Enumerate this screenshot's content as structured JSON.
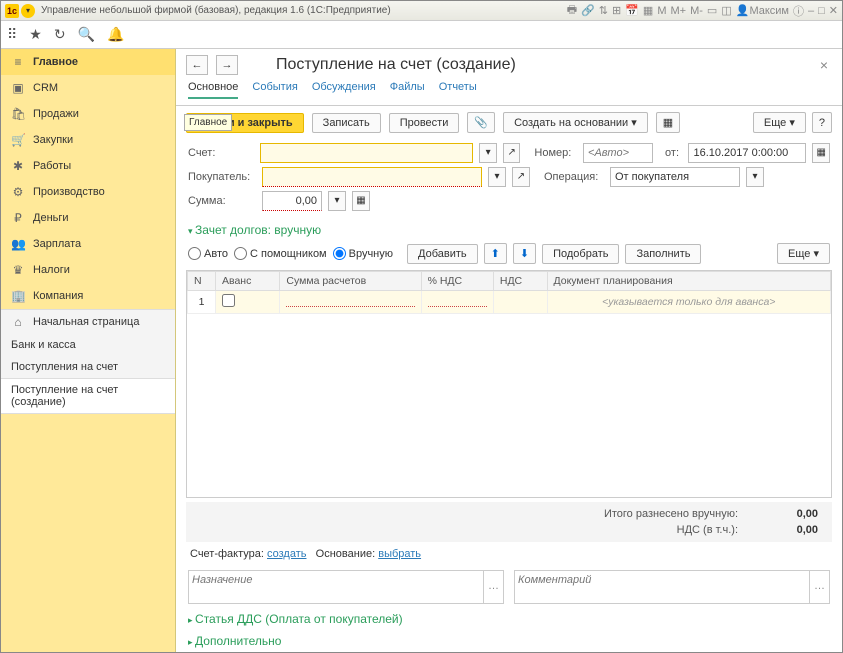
{
  "title": "Управление небольшой фирмой (базовая), редакция 1.6 (1С:Предприятие)",
  "user": "Максим",
  "sidebar": {
    "items": [
      {
        "icon": "≡",
        "label": "Главное"
      },
      {
        "icon": "▣",
        "label": "CRM"
      },
      {
        "icon": "🛍",
        "label": "Продажи"
      },
      {
        "icon": "🛒",
        "label": "Закупки"
      },
      {
        "icon": "✱",
        "label": "Работы"
      },
      {
        "icon": "⚙",
        "label": "Производство"
      },
      {
        "icon": "₽",
        "label": "Деньги"
      },
      {
        "icon": "👥",
        "label": "Зарплата"
      },
      {
        "icon": "♛",
        "label": "Налоги"
      },
      {
        "icon": "🏢",
        "label": "Компания"
      }
    ],
    "sub": [
      {
        "icon": "⌂",
        "label": "Начальная страница"
      },
      {
        "label": "Банк и касса"
      },
      {
        "label": "Поступления на счет"
      },
      {
        "label": "Поступление на счет (создание)"
      }
    ]
  },
  "doc": {
    "title": "Поступление на счет (создание)",
    "tabs": [
      "Основное",
      "События",
      "Обсуждения",
      "Файлы",
      "Отчеты"
    ],
    "tooltip": "Главное",
    "cmd": {
      "post_close": "овести и закрыть",
      "save": "Записать",
      "post": "Провести",
      "create_based": "Создать на основании",
      "more": "Еще"
    },
    "fields": {
      "account_lbl": "Счет:",
      "buyer_lbl": "Покупатель:",
      "sum_lbl": "Сумма:",
      "sum_val": "0,00",
      "number_lbl": "Номер:",
      "number_ph": "<Авто>",
      "from_lbl": "от:",
      "date_val": "16.10.2017 0:00:00",
      "operation_lbl": "Операция:",
      "operation_val": "От покупателя"
    },
    "section1": "Зачет долгов: вручную",
    "radios": {
      "auto": "Авто",
      "assist": "С помощником",
      "manual": "Вручную"
    },
    "gridcmd": {
      "add": "Добавить",
      "pick": "Подобрать",
      "fill": "Заполнить",
      "more": "Еще"
    },
    "cols": {
      "n": "N",
      "advance": "Аванс",
      "sum": "Сумма расчетов",
      "vatpct": "% НДС",
      "vat": "НДС",
      "plan": "Документ планирования"
    },
    "row": {
      "n": "1",
      "plan_ph": "<указывается только для аванса>"
    },
    "totals": {
      "manual_lbl": "Итого разнесено вручную:",
      "manual_val": "0,00",
      "vat_lbl": "НДС (в т.ч.):",
      "vat_val": "0,00"
    },
    "invoice": {
      "pre": "Счет-фактура:",
      "create": "создать",
      "base": "Основание:",
      "pick": "выбрать"
    },
    "ta": {
      "purpose": "Назначение",
      "comment": "Комментарий"
    },
    "section2": "Статья ДДС (Оплата от покупателей)",
    "section3": "Дополнительно"
  }
}
